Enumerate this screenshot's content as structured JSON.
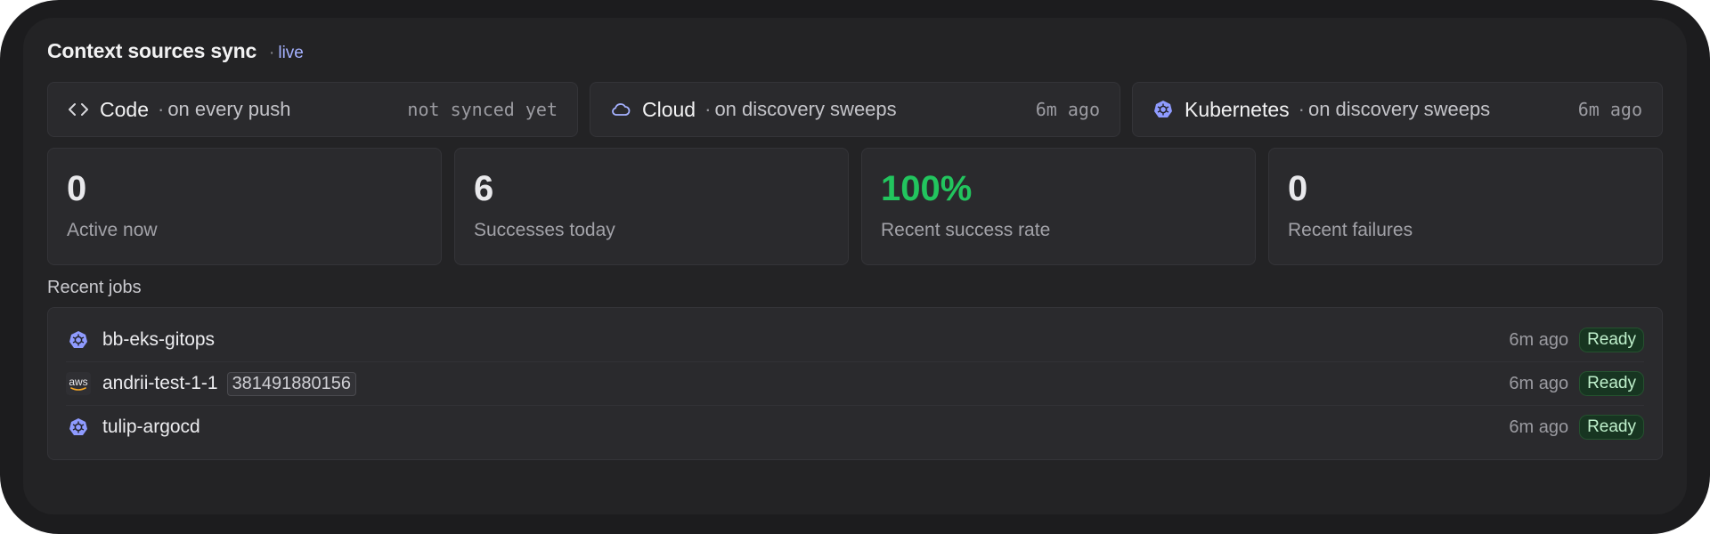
{
  "header": {
    "title": "Context sources sync",
    "live_dot": "·",
    "live": "live"
  },
  "sources": [
    {
      "name": "Code",
      "mode": "on every push",
      "time": "not synced yet",
      "icon": "code-icon"
    },
    {
      "name": "Cloud",
      "mode": "on discovery sweeps",
      "time": "6m ago",
      "icon": "cloud-icon"
    },
    {
      "name": "Kubernetes",
      "mode": "on discovery sweeps",
      "time": "6m ago",
      "icon": "kubernetes-icon"
    }
  ],
  "source_mode_dot": "·",
  "stats": [
    {
      "value": "0",
      "label": "Active now"
    },
    {
      "value": "6",
      "label": "Successes today"
    },
    {
      "value": "100%",
      "label": "Recent success rate"
    },
    {
      "value": "0",
      "label": "Recent failures"
    }
  ],
  "jobs_section": {
    "title": "Recent jobs"
  },
  "jobs": [
    {
      "name": "bb-eks-gitops",
      "time": "6m ago",
      "status": "Ready",
      "icon": "kubernetes-icon"
    },
    {
      "name": "andrii-test-1-1",
      "account_id": "381491880156",
      "time": "6m ago",
      "status": "Ready",
      "icon": "aws-icon",
      "icon_text": "aws"
    },
    {
      "name": "tulip-argocd",
      "time": "6m ago",
      "status": "Ready",
      "icon": "kubernetes-icon"
    }
  ],
  "colors": {
    "accent": "#a5b1ff",
    "success": "#22c55e",
    "ready_bg": "#173521",
    "ready_text": "#bff0cc",
    "kube": "#8f9bff"
  }
}
